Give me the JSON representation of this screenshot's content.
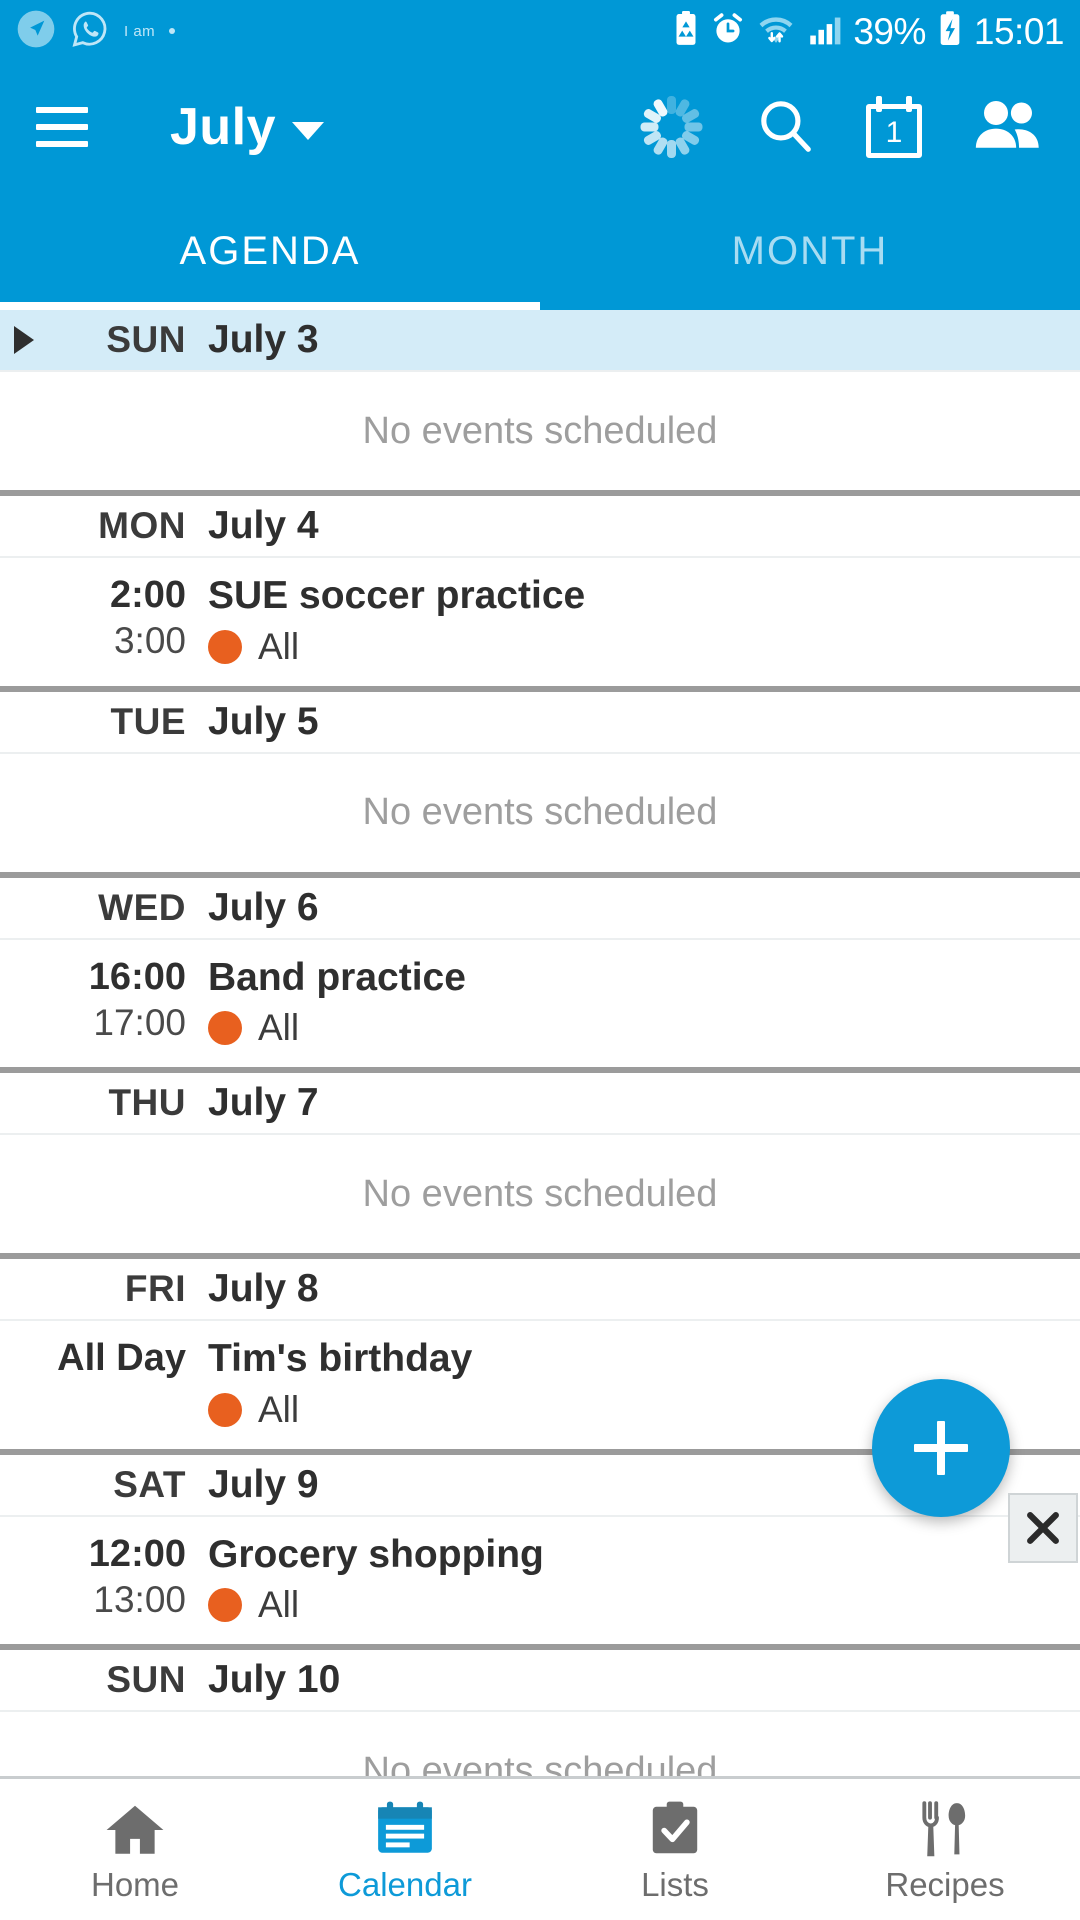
{
  "status_bar": {
    "left_icons": [
      "navigation-icon",
      "whatsapp-icon"
    ],
    "carrier_text": "I am",
    "right_icons": [
      "battery-saver-icon",
      "alarm-icon",
      "wifi-icon",
      "signal-icon",
      "charging-battery-icon"
    ],
    "battery_percent": "39%",
    "time": "15:01"
  },
  "app_bar": {
    "menu_icon": "hamburger-icon",
    "title": "July",
    "dropdown_icon": "caret-down-icon",
    "actions": [
      {
        "name": "sync-spinner",
        "icon": "loading-spinner-icon"
      },
      {
        "name": "search",
        "icon": "search-icon"
      },
      {
        "name": "today",
        "icon": "calendar-day-icon",
        "badge": "1"
      },
      {
        "name": "people",
        "icon": "people-icon"
      }
    ]
  },
  "tabs": [
    {
      "label": "AGENDA",
      "active": true
    },
    {
      "label": "MONTH",
      "active": false
    }
  ],
  "agenda": {
    "empty_text": "No events scheduled",
    "calendar_color": "#e8601f",
    "today_highlight": "#d4ecf8",
    "days": [
      {
        "dow": "SUN",
        "date": "July 3",
        "today": true,
        "events": []
      },
      {
        "dow": "MON",
        "date": "July 4",
        "today": false,
        "events": [
          {
            "start": "2:00",
            "end": "3:00",
            "title": "SUE soccer practice",
            "calendar": "All",
            "color": "#e8601f"
          }
        ]
      },
      {
        "dow": "TUE",
        "date": "July 5",
        "today": false,
        "events": []
      },
      {
        "dow": "WED",
        "date": "July 6",
        "today": false,
        "events": [
          {
            "start": "16:00",
            "end": "17:00",
            "title": "Band practice",
            "calendar": "All",
            "color": "#e8601f"
          }
        ]
      },
      {
        "dow": "THU",
        "date": "July 7",
        "today": false,
        "events": []
      },
      {
        "dow": "FRI",
        "date": "July 8",
        "today": false,
        "events": [
          {
            "start": "All Day",
            "end": "",
            "title": "Tim's birthday",
            "calendar": "All",
            "color": "#e8601f"
          }
        ]
      },
      {
        "dow": "SAT",
        "date": "July 9",
        "today": false,
        "events": [
          {
            "start": "12:00",
            "end": "13:00",
            "title": "Grocery shopping",
            "calendar": "All",
            "color": "#e8601f"
          }
        ]
      },
      {
        "dow": "SUN",
        "date": "July 10",
        "today": false,
        "events": []
      }
    ]
  },
  "fab": {
    "icon": "plus-icon",
    "label": ""
  },
  "close_button": {
    "icon": "close-icon"
  },
  "bottom_nav": [
    {
      "label": "Home",
      "icon": "home-icon",
      "active": false
    },
    {
      "label": "Calendar",
      "icon": "calendar-icon",
      "active": true
    },
    {
      "label": "Lists",
      "icon": "clipboard-check-icon",
      "active": false
    },
    {
      "label": "Recipes",
      "icon": "fork-spoon-icon",
      "active": false
    }
  ],
  "theme": {
    "primary": "#0098d6",
    "accent": "#0d9ad8",
    "event_dot": "#e8601f",
    "today_row": "#d4ecf8"
  }
}
